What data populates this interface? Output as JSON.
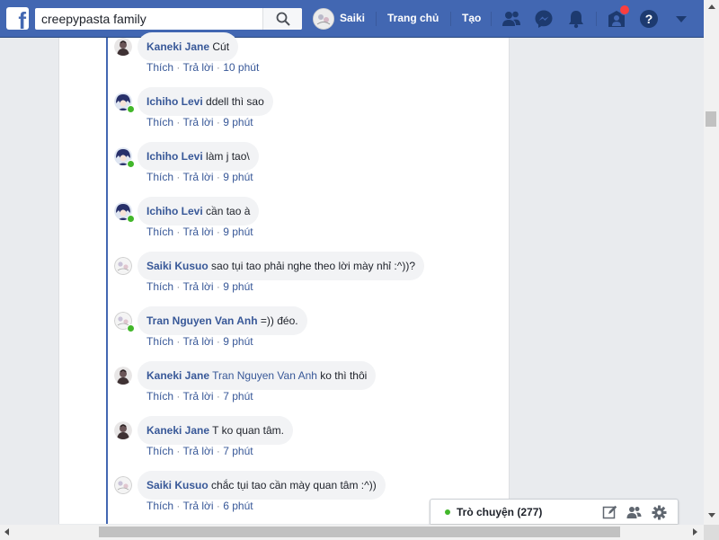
{
  "header": {
    "logo_letter": "f",
    "search": {
      "value": "creepypasta family"
    },
    "profile_name": "Saiki",
    "home_label": "Trang chủ",
    "create_label": "Tạo",
    "icons": [
      "friend-requests-icon",
      "messenger-icon",
      "notifications-icon",
      "groups-icon",
      "help-icon",
      "account-menu-icon"
    ],
    "brand_color": "#4267b2"
  },
  "comments": [
    {
      "author": "Kaneki Jane",
      "text": "Cút",
      "mention": "",
      "like": "Thích",
      "reply": "Trả lời",
      "time": "10 phút",
      "online": false,
      "avatar": "dark"
    },
    {
      "author": "Ichiho Levi",
      "text": "ddell thì sao",
      "mention": "",
      "like": "Thích",
      "reply": "Trả lời",
      "time": "9 phút",
      "online": true,
      "avatar": "anime"
    },
    {
      "author": "Ichiho Levi",
      "text": "làm j tao\\",
      "mention": "",
      "like": "Thích",
      "reply": "Trả lời",
      "time": "9 phút",
      "online": true,
      "avatar": "anime"
    },
    {
      "author": "Ichiho Levi",
      "text": "cần tao à",
      "mention": "",
      "like": "Thích",
      "reply": "Trả lời",
      "time": "9 phút",
      "online": true,
      "avatar": "anime"
    },
    {
      "author": "Saiki Kusuo",
      "text": "sao tụi tao phải nghe theo lời mày nhỉ :^))?",
      "mention": "",
      "like": "Thích",
      "reply": "Trả lời",
      "time": "9 phút",
      "online": false,
      "avatar": "light"
    },
    {
      "author": "Tran Nguyen Van Anh",
      "text": "=)) đéo.",
      "mention": "",
      "like": "Thích",
      "reply": "Trả lời",
      "time": "9 phút",
      "online": true,
      "avatar": "light"
    },
    {
      "author": "Kaneki Jane",
      "text": "ko thì thôi",
      "mention": "Tran Nguyen Van Anh",
      "like": "Thích",
      "reply": "Trả lời",
      "time": "7 phút",
      "online": false,
      "avatar": "dark"
    },
    {
      "author": "Kaneki Jane",
      "text": "T ko quan tâm.",
      "mention": "",
      "like": "Thích",
      "reply": "Trả lời",
      "time": "7 phút",
      "online": false,
      "avatar": "dark"
    },
    {
      "author": "Saiki Kusuo",
      "text": "chắc tụi tao cần mày quan tâm :^))",
      "mention": "",
      "like": "Thích",
      "reply": "Trả lời",
      "time": "6 phút",
      "online": false,
      "avatar": "light"
    }
  ],
  "chat": {
    "label": "Trò chuyện (277)",
    "status_color": "#42b72a",
    "icons": [
      "compose-icon",
      "new-group-icon",
      "settings-icon"
    ]
  }
}
